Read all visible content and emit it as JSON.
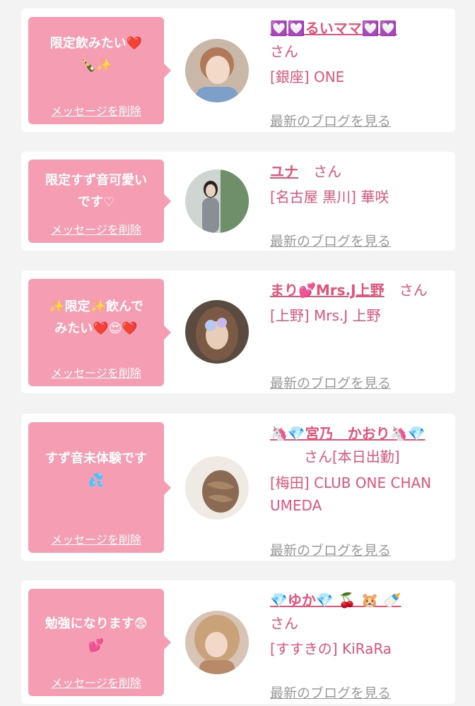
{
  "cards": [
    {
      "message": "限定飲みたい❤️\n🍾✨",
      "delete_label": "メッセージを削除",
      "name": "💟💟るいママ💟💟",
      "honorific": "さん",
      "shop": "[銀座] ONE",
      "blog_link": "最新のブログを見る"
    },
    {
      "message": "限定すず音可愛い\nです♡",
      "delete_label": "メッセージを削除",
      "name": "ユナ",
      "honorific": "さん",
      "shop": "[名古屋 黒川] 華咲",
      "blog_link": "最新のブログを見る"
    },
    {
      "message": "✨限定✨飲んで\nみたい❤️😍❤️",
      "delete_label": "メッセージを削除",
      "name": "まり💕Mrs.J上野",
      "honorific": "さん",
      "shop": "[上野] Mrs.J 上野",
      "blog_link": "最新のブログを見る"
    },
    {
      "message": "すず音未体験です\n💦",
      "delete_label": "メッセージを削除",
      "name": "🦄💎宮乃　かおり🦄💎",
      "honorific": "さん[本日出勤]",
      "shop": "[梅田] CLUB ONE CHAN UMEDA",
      "blog_link": "最新のブログを見る"
    },
    {
      "message": "勉強になります😨\n💕",
      "delete_label": "メッセージを削除",
      "name": "💎ゆか💎 🍒 🐹 🍼",
      "honorific": "さん",
      "shop": "[すすきの] KiRaRa",
      "blog_link": "最新のブログを見る"
    }
  ],
  "colors": {
    "accent": "#e25478",
    "bubble": "#f59db2",
    "link_gray": "#9a9a9a",
    "background": "#f3f3f3"
  }
}
